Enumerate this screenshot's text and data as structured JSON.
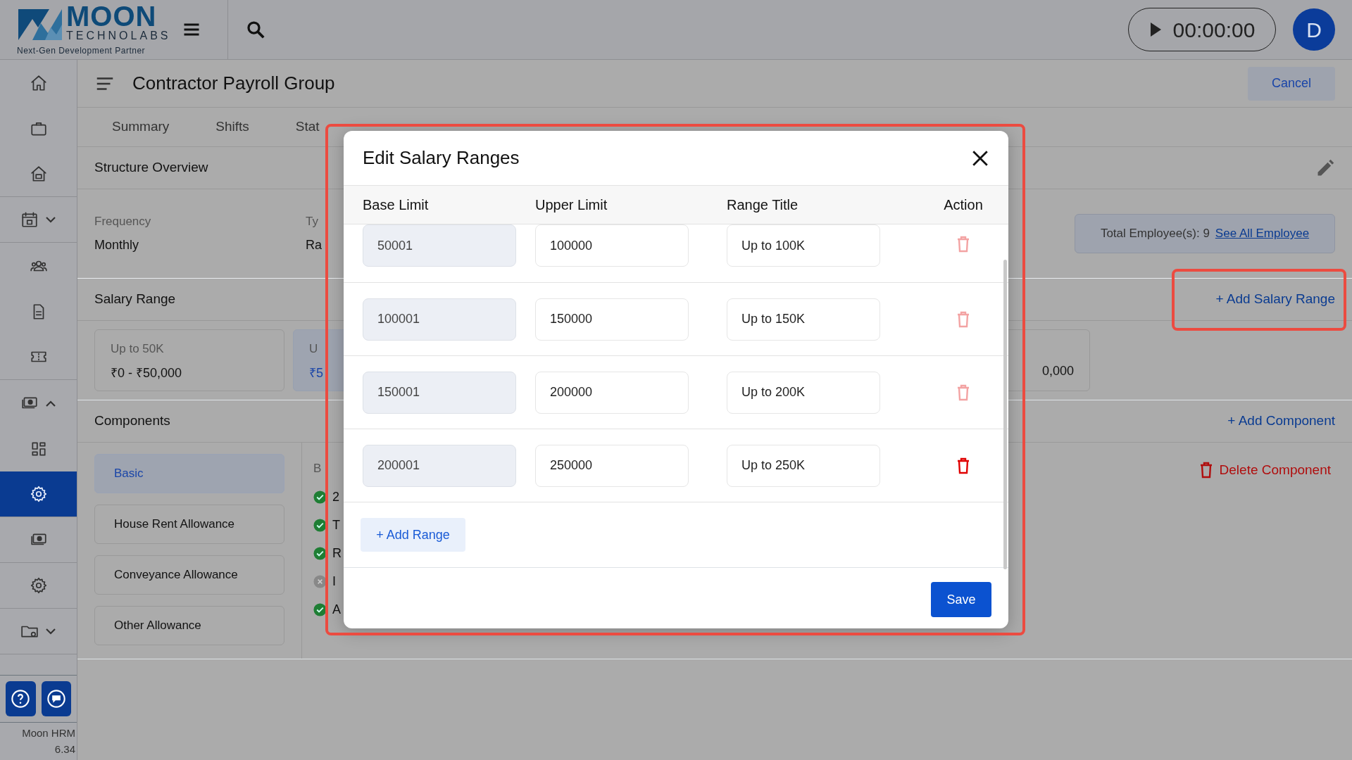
{
  "header": {
    "logo": {
      "name": "MOON",
      "subname": "TECHNOLABS",
      "tagline": "Next-Gen Development Partner"
    },
    "timer": "00:00:00",
    "avatar": "D"
  },
  "sidebar": {
    "items": [
      {
        "selected": false
      },
      {
        "selected": false
      },
      {
        "selected": false
      },
      {
        "selected": false,
        "expanded": false
      },
      {
        "selected": false
      },
      {
        "selected": false
      },
      {
        "selected": false
      },
      {
        "selected": false,
        "expanded": true
      },
      {
        "selected": false
      },
      {
        "selected": true
      },
      {
        "selected": false
      },
      {
        "selected": false
      },
      {
        "selected": false,
        "expanded": false
      }
    ],
    "app_name": "Moon HRM",
    "version": "6.34"
  },
  "page": {
    "title": "Contractor Payroll Group",
    "cancel": "Cancel",
    "tabs": [
      {
        "label": "Summary",
        "selected": false
      },
      {
        "label": "Shifts",
        "selected": false
      },
      {
        "label": "Stat",
        "selected": false
      }
    ],
    "overview": {
      "title": "Structure Overview",
      "fields": [
        {
          "label": "Frequency",
          "value": "Monthly"
        },
        {
          "label": "Ty",
          "value": "Ra"
        }
      ],
      "total": "Total Employee(s): 9",
      "see_all": "See All Employee"
    },
    "salary_range": {
      "title": "Salary Range",
      "add": "+ Add Salary Range",
      "cards": [
        {
          "title": "Up to 50K",
          "amount": "₹0 - ₹50,000",
          "selected": false
        },
        {
          "title": "U",
          "amount": "₹5",
          "selected": true
        },
        {
          "amount": "0,000",
          "selected": false
        }
      ]
    },
    "components": {
      "title": "Components",
      "add": "+ Add Component",
      "delete": "Delete Component",
      "items": [
        {
          "label": "Basic",
          "selected": true
        },
        {
          "label": "House Rent Allowance",
          "selected": false
        },
        {
          "label": "Conveyance Allowance",
          "selected": false
        },
        {
          "label": "Other Allowance",
          "selected": false
        }
      ],
      "detail_title": "B",
      "detail_items": [
        {
          "text": "2",
          "checked": true
        },
        {
          "text": "T",
          "checked": true
        },
        {
          "text": "R",
          "checked": true
        },
        {
          "text": "I",
          "checked": false
        },
        {
          "text": "A",
          "checked": true
        }
      ]
    }
  },
  "modal": {
    "title": "Edit Salary Ranges",
    "columns": [
      "Base Limit",
      "Upper Limit",
      "Range Title",
      "Action"
    ],
    "rows": [
      {
        "base": "50001",
        "upper": "100000",
        "title": "Up to 100K",
        "base_disabled": true,
        "delete_disabled": true
      },
      {
        "base": "100001",
        "upper": "150000",
        "title": "Up to 150K",
        "base_disabled": true,
        "delete_disabled": true
      },
      {
        "base": "150001",
        "upper": "200000",
        "title": "Up to 200K",
        "base_disabled": true,
        "delete_disabled": true
      },
      {
        "base": "200001",
        "upper": "250000",
        "title": "Up to 250K",
        "base_disabled": true,
        "delete_disabled": false
      }
    ],
    "add": "+ Add Range",
    "save": "Save"
  }
}
